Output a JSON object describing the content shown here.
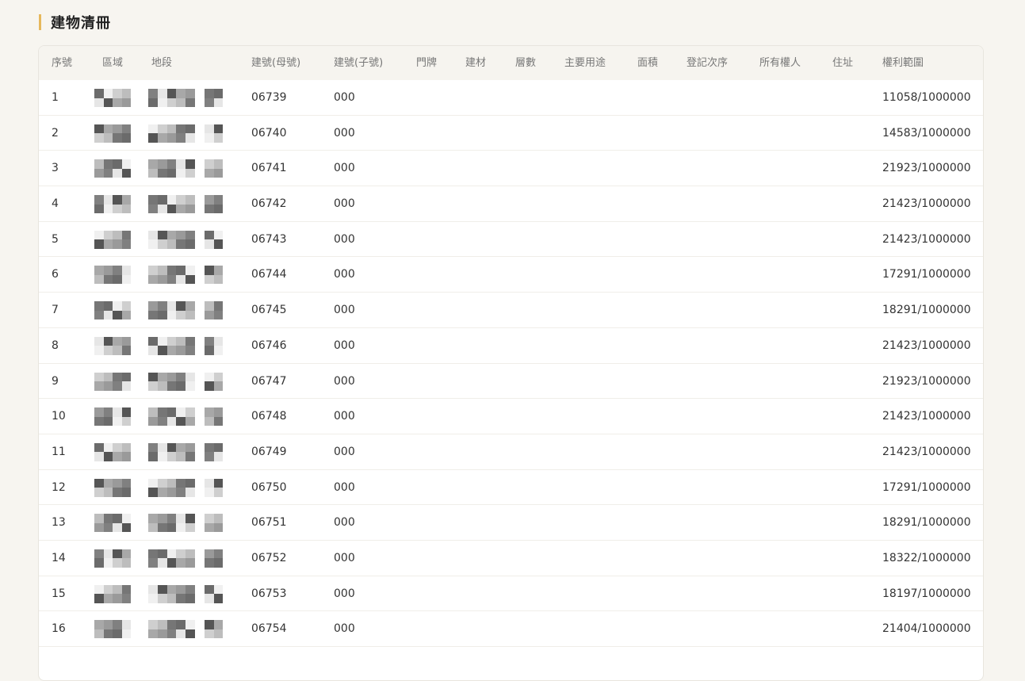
{
  "section": {
    "title": "建物清冊"
  },
  "colors": {
    "accent": "#e6b85c",
    "header_bg": "#f6f4ef"
  },
  "table": {
    "columns": [
      {
        "key": "seq",
        "label": "序號"
      },
      {
        "key": "district",
        "label": "區域"
      },
      {
        "key": "land_section",
        "label": "地段"
      },
      {
        "key": "building_no_parent",
        "label": "建號(母號)"
      },
      {
        "key": "building_no_child",
        "label": "建號(子號)"
      },
      {
        "key": "door_plate",
        "label": "門牌"
      },
      {
        "key": "material",
        "label": "建材"
      },
      {
        "key": "floors",
        "label": "層數"
      },
      {
        "key": "main_use",
        "label": "主要用途"
      },
      {
        "key": "area",
        "label": "面積"
      },
      {
        "key": "reg_order",
        "label": "登記次序"
      },
      {
        "key": "owner",
        "label": "所有權人"
      },
      {
        "key": "address",
        "label": "住址"
      },
      {
        "key": "rights_scope",
        "label": "權利範圍"
      }
    ],
    "rows": [
      {
        "seq": "1",
        "parent": "06739",
        "child": "000",
        "scope": "11058/1000000"
      },
      {
        "seq": "2",
        "parent": "06740",
        "child": "000",
        "scope": "14583/1000000"
      },
      {
        "seq": "3",
        "parent": "06741",
        "child": "000",
        "scope": "21923/1000000"
      },
      {
        "seq": "4",
        "parent": "06742",
        "child": "000",
        "scope": "21423/1000000"
      },
      {
        "seq": "5",
        "parent": "06743",
        "child": "000",
        "scope": "21423/1000000"
      },
      {
        "seq": "6",
        "parent": "06744",
        "child": "000",
        "scope": "17291/1000000"
      },
      {
        "seq": "7",
        "parent": "06745",
        "child": "000",
        "scope": "18291/1000000"
      },
      {
        "seq": "8",
        "parent": "06746",
        "child": "000",
        "scope": "21423/1000000"
      },
      {
        "seq": "9",
        "parent": "06747",
        "child": "000",
        "scope": "21923/1000000"
      },
      {
        "seq": "10",
        "parent": "06748",
        "child": "000",
        "scope": "21423/1000000"
      },
      {
        "seq": "11",
        "parent": "06749",
        "child": "000",
        "scope": "21423/1000000"
      },
      {
        "seq": "12",
        "parent": "06750",
        "child": "000",
        "scope": "17291/1000000"
      },
      {
        "seq": "13",
        "parent": "06751",
        "child": "000",
        "scope": "18291/1000000"
      },
      {
        "seq": "14",
        "parent": "06752",
        "child": "000",
        "scope": "18322/1000000"
      },
      {
        "seq": "15",
        "parent": "06753",
        "child": "000",
        "scope": "18197/1000000"
      },
      {
        "seq": "16",
        "parent": "06754",
        "child": "000",
        "scope": "21404/1000000"
      }
    ]
  }
}
